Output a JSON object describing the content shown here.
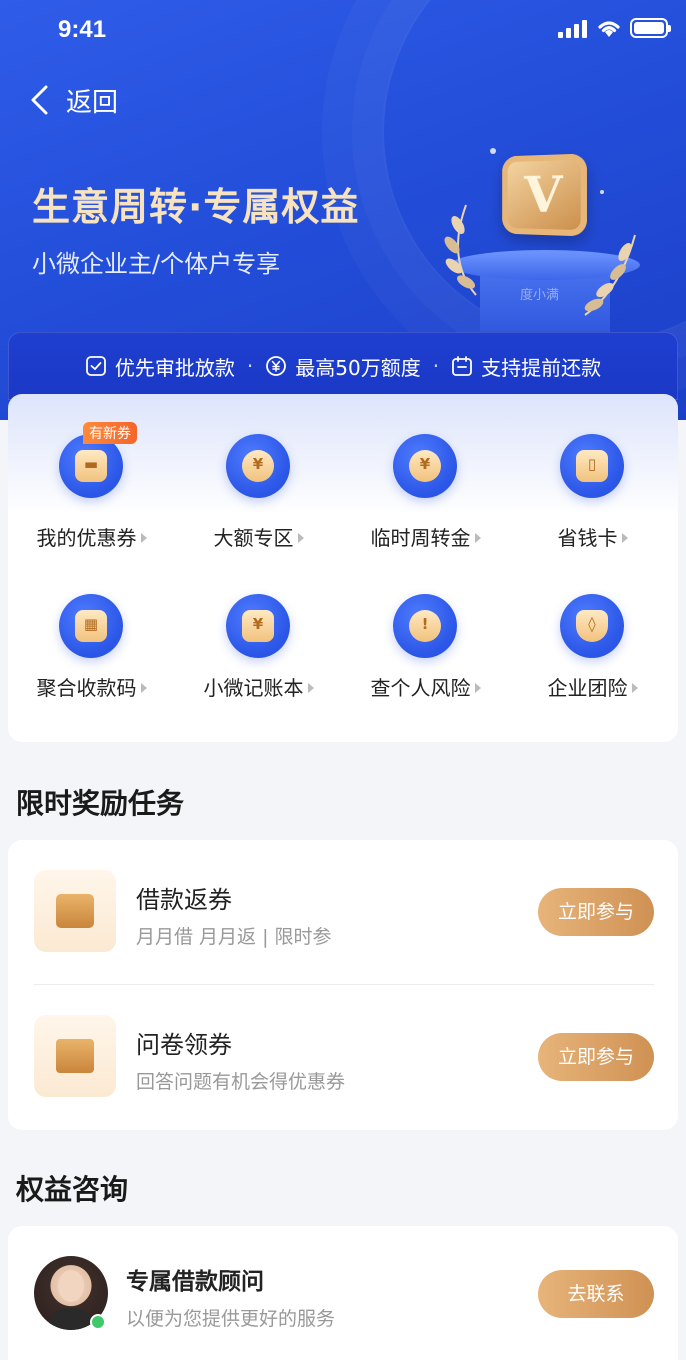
{
  "status_bar": {
    "time": "9:41"
  },
  "nav": {
    "back_label": "返回"
  },
  "hero": {
    "title": "生意周转·专属权益",
    "subtitle": "小微企业主/个体户专享",
    "podium_label": "度小满"
  },
  "benefits": [
    {
      "icon": "check-square-icon",
      "label": "优先审批放款"
    },
    {
      "icon": "yuan-circle-icon",
      "label": "最高50万额度"
    },
    {
      "icon": "calendar-icon",
      "label": "支持提前还款"
    }
  ],
  "services": [
    {
      "label": "我的优惠券",
      "icon": "coupon-icon",
      "tag": "有新券"
    },
    {
      "label": "大额专区",
      "icon": "yuan-badge-icon"
    },
    {
      "label": "临时周转金",
      "icon": "money-bag-icon"
    },
    {
      "label": "省钱卡",
      "icon": "savings-card-icon"
    },
    {
      "label": "聚合收款码",
      "icon": "qr-code-icon"
    },
    {
      "label": "小微记账本",
      "icon": "ledger-book-icon"
    },
    {
      "label": "查个人风险",
      "icon": "risk-alarm-icon"
    },
    {
      "label": "企业团险",
      "icon": "shield-icon"
    }
  ],
  "tasks_section": {
    "title": "限时奖励任务",
    "tasks": [
      {
        "name": "借款返券",
        "desc": "月月借 月月返 | 限时参",
        "button": "立即参与",
        "icon": "ticket-icon"
      },
      {
        "name": "问卷领券",
        "desc": "回答问题有机会得优惠券",
        "button": "立即参与",
        "icon": "gift-box-icon"
      }
    ]
  },
  "consult_section": {
    "title": "权益咨询",
    "advisor": {
      "name": "专属借款顾问",
      "desc": "以便为您提供更好的服务",
      "button": "去联系"
    }
  },
  "colors": {
    "primary_blue": "#2450dc",
    "gold": "#cf9154",
    "title_gold": "#f7e3c0"
  }
}
